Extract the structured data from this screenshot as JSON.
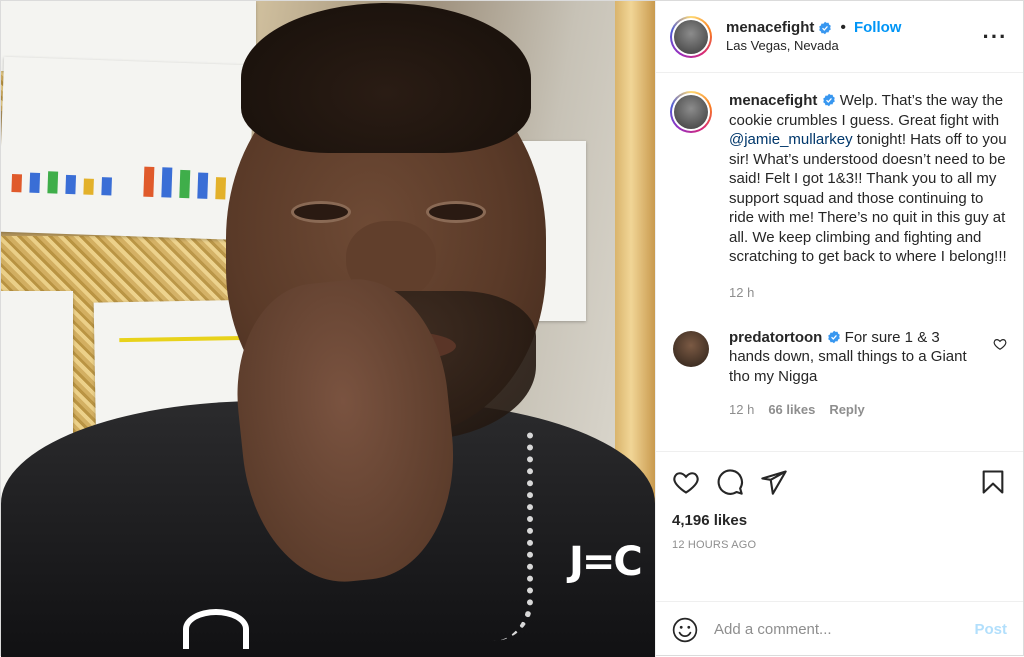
{
  "post": {
    "author": {
      "username": "menacefight",
      "verified": true,
      "follow_label": "Follow",
      "location": "Las Vegas, Nevada"
    },
    "more_icon": "more-horizontal-icon",
    "caption": {
      "username": "menacefight",
      "text_before_mention": "Welp. That’s the way the cookie crumbles I guess. Great fight with ",
      "mention": "@jamie_mullarkey",
      "text_after_mention": " tonight! Hats off to you sir! What’s understood doesn’t need to be said! Felt I got 1&3!! Thank you to all my support squad and those continuing to ride with me! There’s no quit in this guy at all. We keep climbing and fighting and scratching to get back to where I belong!!!",
      "age": "12 h"
    },
    "comments": [
      {
        "username": "predatortoon",
        "verified": true,
        "text": "For sure 1 & 3 hands down, small things to a Giant tho my Nigga",
        "age": "12 h",
        "likes": "66 likes",
        "reply_label": "Reply"
      }
    ],
    "actions": {
      "icons": [
        "heart-icon",
        "comment-icon",
        "share-icon",
        "bookmark-icon"
      ]
    },
    "likes": "4,196 likes",
    "timestamp": "12 HOURS AGO",
    "add_comment": {
      "placeholder": "Add a comment...",
      "post_label": "Post"
    },
    "colors": {
      "accent": "#0095f6",
      "post_disabled": "#b2dffc",
      "muted": "#8e8e8e",
      "mention": "#00376b"
    }
  }
}
